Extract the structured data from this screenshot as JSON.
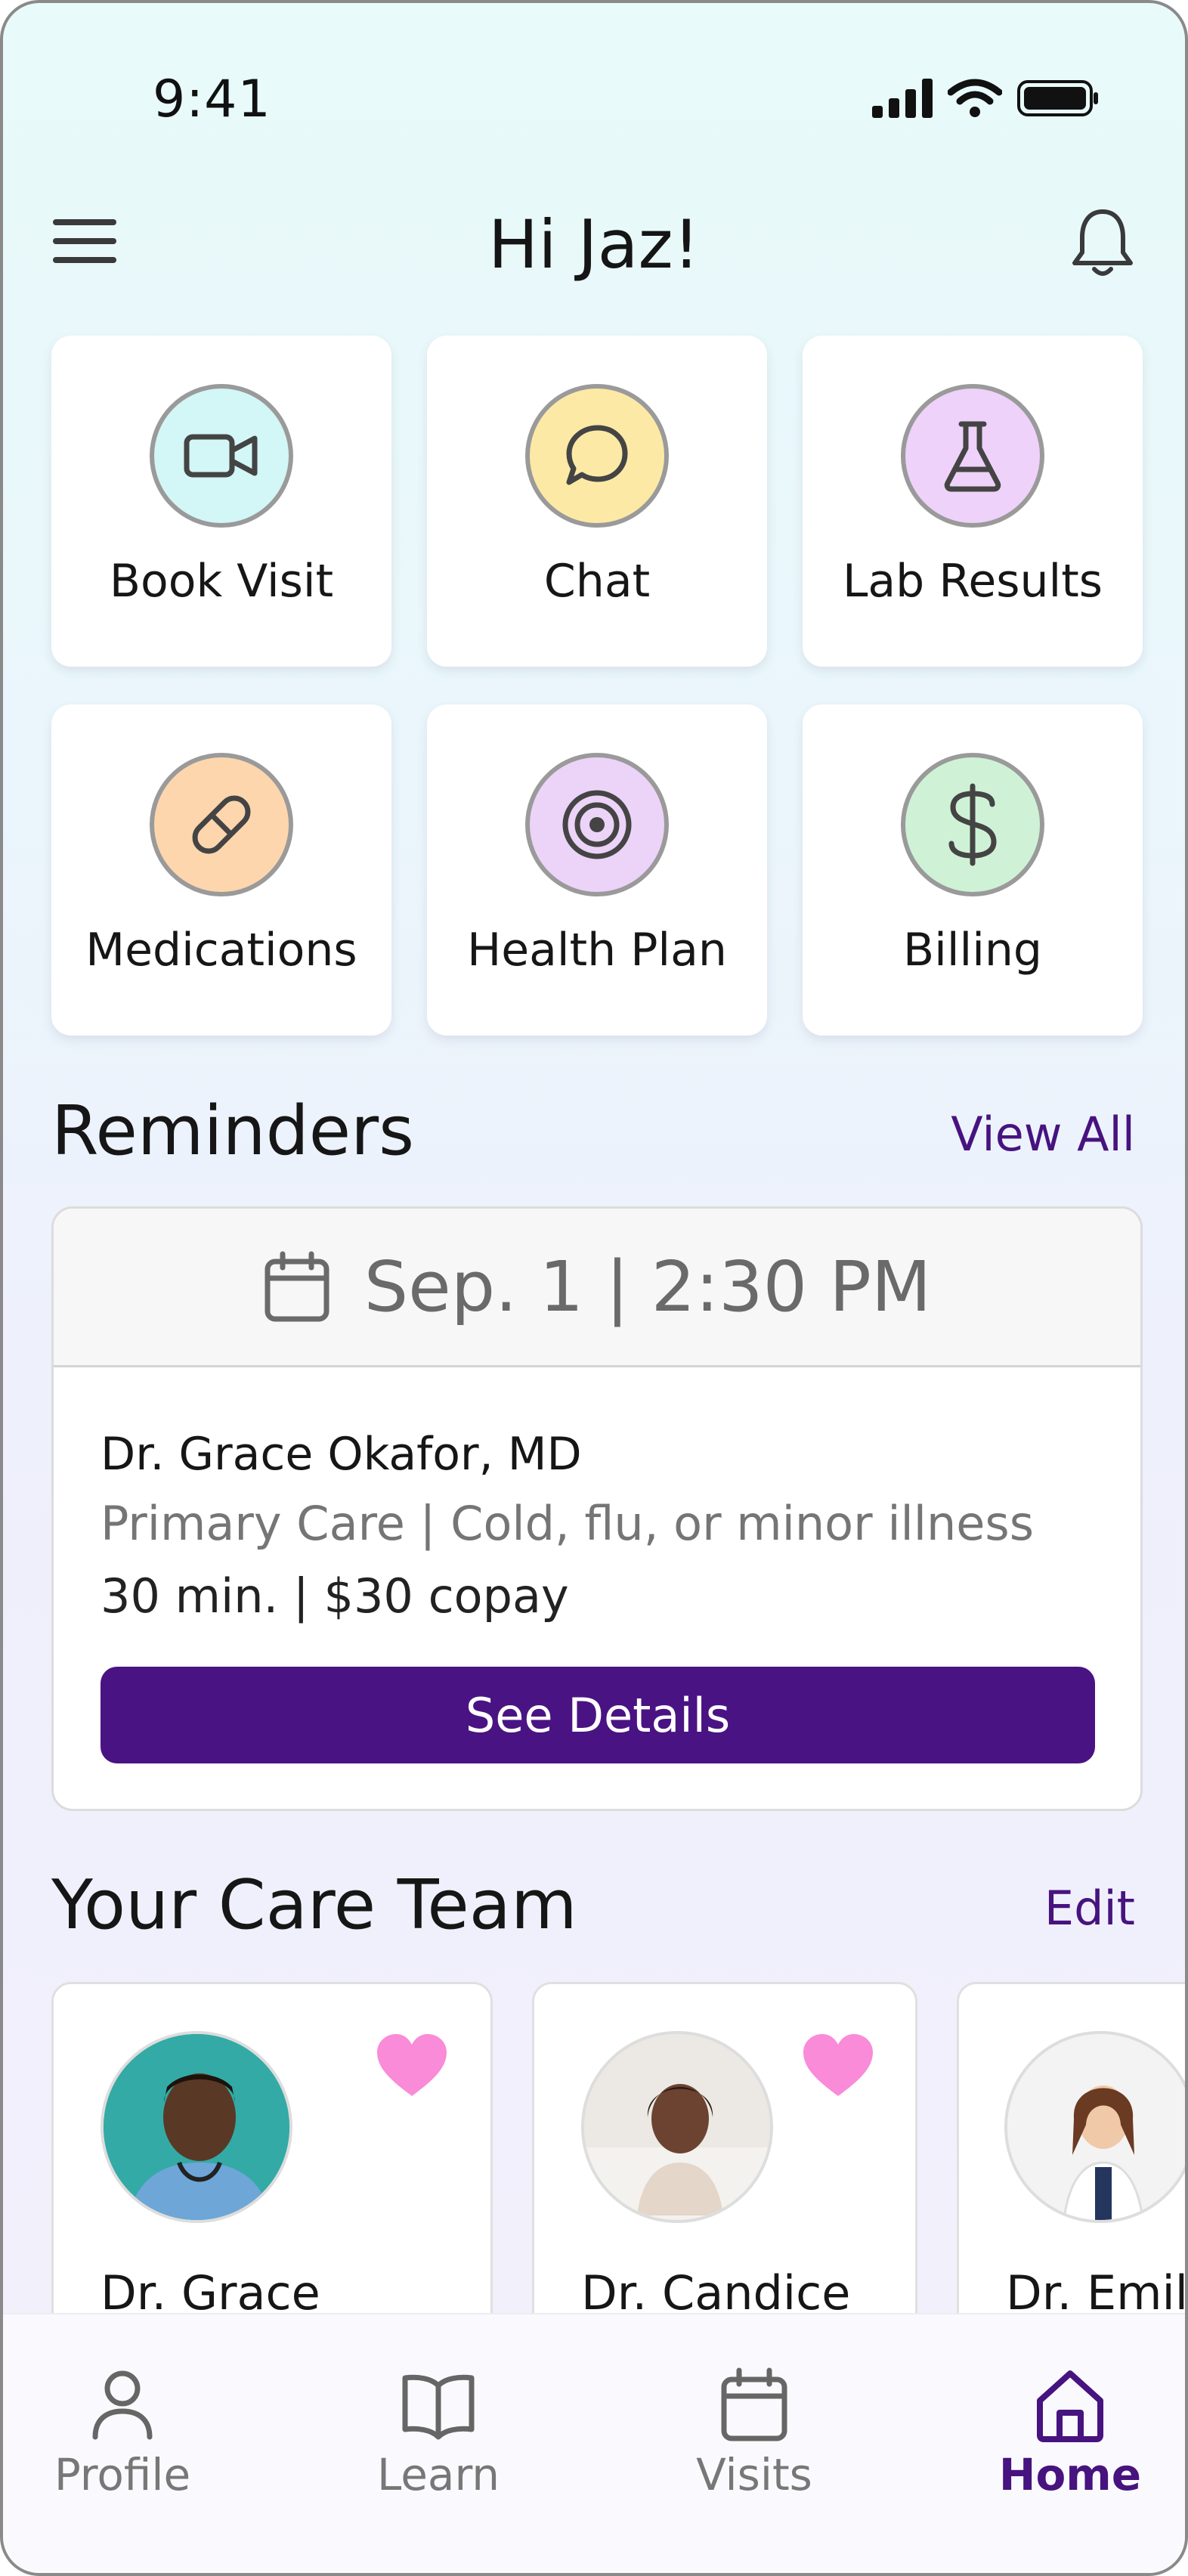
{
  "status_bar": {
    "time": "9:41"
  },
  "header": {
    "greeting": "Hi Jaz!"
  },
  "quick_actions": [
    {
      "label": "Book Visit",
      "icon": "video-camera-icon",
      "color": "#d3f6f6"
    },
    {
      "label": "Chat",
      "icon": "chat-bubble-icon",
      "color": "#fde9a6"
    },
    {
      "label": "Lab Results",
      "icon": "flask-icon",
      "color": "#eed2f9"
    },
    {
      "label": "Medications",
      "icon": "pill-icon",
      "color": "#fdd6ad"
    },
    {
      "label": "Health Plan",
      "icon": "target-icon",
      "color": "#ecd3f8"
    },
    {
      "label": "Billing",
      "icon": "dollar-icon",
      "color": "#cff2d6"
    }
  ],
  "reminders": {
    "title": "Reminders",
    "view_all": "View All",
    "card": {
      "date": "Sep. 1 | 2:30 PM",
      "doctor": "Dr. Grace Okafor, MD",
      "specialty": "Primary Care | Cold, flu, or minor illness",
      "meta": "30 min. | $30 copay",
      "button": "See Details"
    }
  },
  "care_team": {
    "title": "Your Care Team",
    "edit": "Edit",
    "members": [
      {
        "name": "Dr. Grace",
        "favorite": true
      },
      {
        "name": "Dr. Candice",
        "favorite": true
      },
      {
        "name": "Dr. Emily",
        "favorite": false
      }
    ]
  },
  "tabbar": {
    "items": [
      {
        "label": "Profile",
        "icon": "person-icon",
        "active": false
      },
      {
        "label": "Learn",
        "icon": "book-icon",
        "active": false
      },
      {
        "label": "Visits",
        "icon": "calendar-icon",
        "active": false
      },
      {
        "label": "Home",
        "icon": "home-icon",
        "active": true
      }
    ]
  },
  "colors": {
    "accent": "#47137f",
    "heart": "#f98bd8"
  }
}
